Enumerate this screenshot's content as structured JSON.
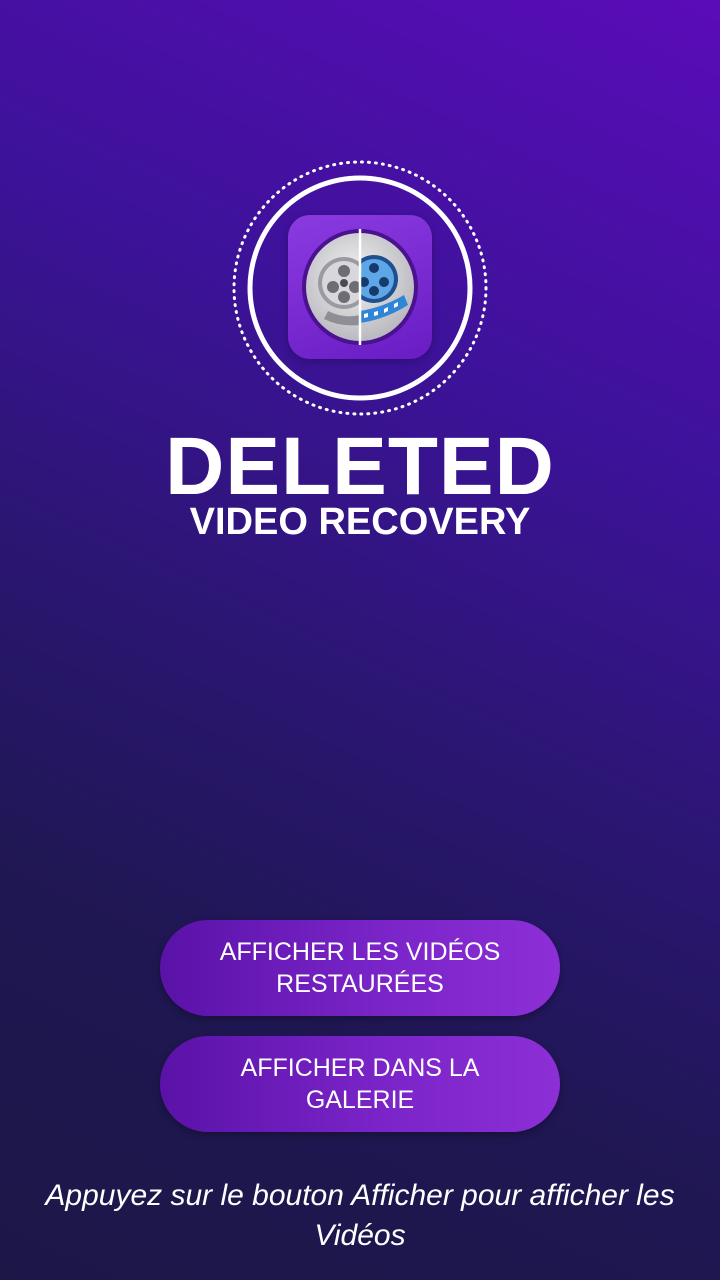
{
  "brand": {
    "title": "DELETED",
    "subtitle": "VIDEO RECOVERY"
  },
  "buttons": {
    "restored_label": "AFFICHER LES VIDÉOS RESTAURÉES",
    "gallery_label": "AFFICHER DANS LA GALERIE"
  },
  "hint": "Appuyez sur le bouton Afficher pour afficher les Vidéos",
  "icons": {
    "logo": "film-reel-recovery-icon"
  },
  "colors": {
    "background_top": "#5a0cb8",
    "background_bottom": "#1d1748",
    "button_start": "#5a12a8",
    "button_end": "#8c2fd6",
    "text": "#ffffff"
  }
}
